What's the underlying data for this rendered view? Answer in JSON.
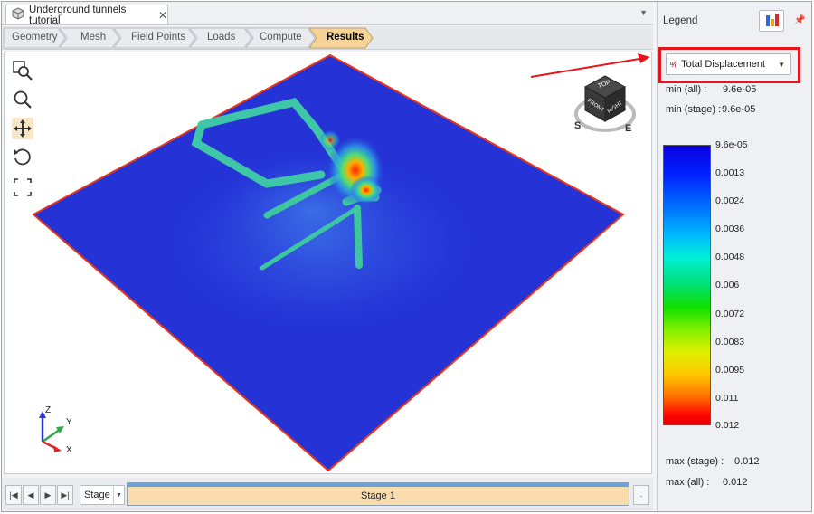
{
  "document_tab": {
    "title": "Underground tunnels tutorial",
    "close": "✕"
  },
  "workflow_tabs": [
    "Geometry",
    "Mesh",
    "Field Points",
    "Loads",
    "Compute",
    "Results"
  ],
  "active_tab": "Results",
  "viewcube": {
    "top": "TOP",
    "front": "FRONT",
    "right": "RIGHT",
    "compass": [
      "S",
      "E"
    ]
  },
  "axes": {
    "z": "Z",
    "y": "Y",
    "x": "X"
  },
  "legend": {
    "title": "Legend",
    "result_type": "Total Displacement",
    "min_all_label": "min (all) :",
    "min_all_value": "9.6e-05",
    "min_stage_label": "min (stage) :",
    "min_stage_value": "9.6e-05",
    "ticks": [
      "9.6e-05",
      "0.0013",
      "0.0024",
      "0.0036",
      "0.0048",
      "0.006",
      "0.0072",
      "0.0083",
      "0.0095",
      "0.011",
      "0.012"
    ],
    "max_stage_label": "max (stage) :",
    "max_stage_value": "0.012",
    "max_all_label": "max (all) :",
    "max_all_value": "0.012"
  },
  "stage": {
    "select_label": "Stage",
    "bar_label": "Stage 1",
    "more": "."
  },
  "colors": {
    "accent_red": "#e8141c",
    "stage_bar": "#f9dcae",
    "active_tab": "#f6d498"
  }
}
